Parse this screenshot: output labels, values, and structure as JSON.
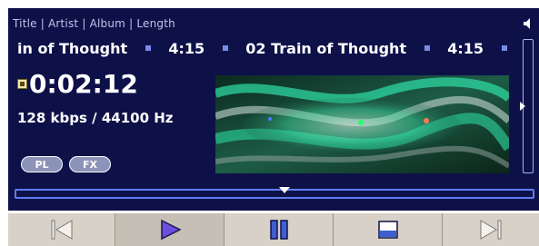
{
  "header": {
    "text": "Title | Artist | Album | Length"
  },
  "ticker": {
    "items": [
      {
        "title": "in of Thought",
        "length": "4:15"
      },
      {
        "title": "02 Train of Thought",
        "length": "4:15"
      }
    ]
  },
  "status": {
    "elapsed": "0:02:12",
    "bitrate": "128 kbps / 44100 Hz"
  },
  "buttons": {
    "pl_label": "PL",
    "fx_label": "FX"
  },
  "transport": {
    "buttons": [
      {
        "name": "previous-button",
        "icon": "skip-back-icon"
      },
      {
        "name": "play-button",
        "icon": "play-icon"
      },
      {
        "name": "pause-button",
        "icon": "pause-icon"
      },
      {
        "name": "stop-button",
        "icon": "stop-icon"
      },
      {
        "name": "next-button",
        "icon": "skip-forward-icon"
      }
    ]
  },
  "colors": {
    "panel_bg": "#0e1148",
    "accent": "#5f7cf0",
    "text": "#ffffff"
  }
}
